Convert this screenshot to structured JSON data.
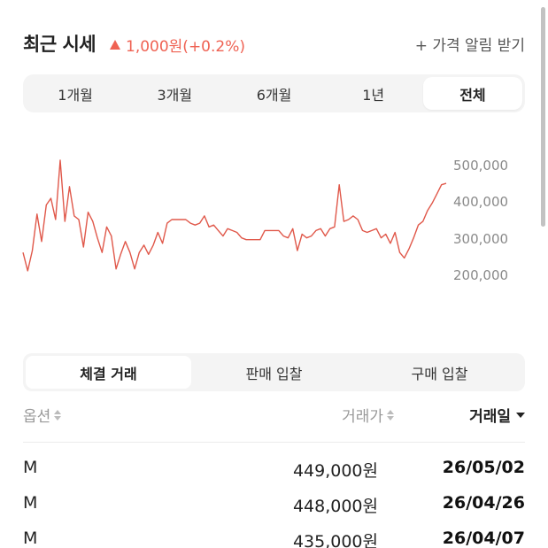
{
  "header": {
    "title": "최근 시세",
    "change": "1,000원(+0.2%)",
    "alert_label": "+ 가격 알림 받기"
  },
  "period_tabs": [
    "1개월",
    "3개월",
    "6개월",
    "1년",
    "전체"
  ],
  "active_period": "전체",
  "chart_data": {
    "type": "line",
    "title": "",
    "xlabel": "",
    "ylabel": "",
    "yticks": [
      "500,000",
      "400,000",
      "300,000",
      "200,000"
    ],
    "ylim": [
      170000,
      520000
    ],
    "grid": false,
    "color": "#e0584a",
    "series": [
      {
        "values": [
          260000,
          210000,
          265000,
          365000,
          290000,
          390000,
          408000,
          350000,
          512000,
          345000,
          440000,
          360000,
          350000,
          275000,
          370000,
          345000,
          300000,
          260000,
          330000,
          305000,
          215000,
          255000,
          290000,
          260000,
          215000,
          260000,
          280000,
          255000,
          280000,
          315000,
          285000,
          340000,
          350000,
          350000,
          350000,
          350000,
          340000,
          335000,
          340000,
          360000,
          330000,
          335000,
          320000,
          305000,
          325000,
          320000,
          315000,
          300000,
          295000,
          295000,
          295000,
          295000,
          320000,
          320000,
          320000,
          320000,
          305000,
          300000,
          325000,
          265000,
          310000,
          300000,
          305000,
          320000,
          325000,
          305000,
          325000,
          330000,
          445000,
          345000,
          350000,
          360000,
          350000,
          320000,
          315000,
          320000,
          325000,
          300000,
          310000,
          285000,
          315000,
          260000,
          245000,
          270000,
          300000,
          335000,
          345000,
          375000,
          395000,
          420000,
          445000,
          449000
        ]
      }
    ]
  },
  "trade_tabs": [
    "체결 거래",
    "판매 입찰",
    "구매 입찰"
  ],
  "active_trade_tab": "체결 거래",
  "table": {
    "columns": {
      "option": "옵션",
      "price": "거래가",
      "date": "거래일"
    },
    "rows": [
      {
        "option": "M",
        "price": "449,000원",
        "date": "26/05/02"
      },
      {
        "option": "M",
        "price": "448,000원",
        "date": "26/04/26"
      },
      {
        "option": "M",
        "price": "435,000원",
        "date": "26/04/07"
      }
    ]
  }
}
